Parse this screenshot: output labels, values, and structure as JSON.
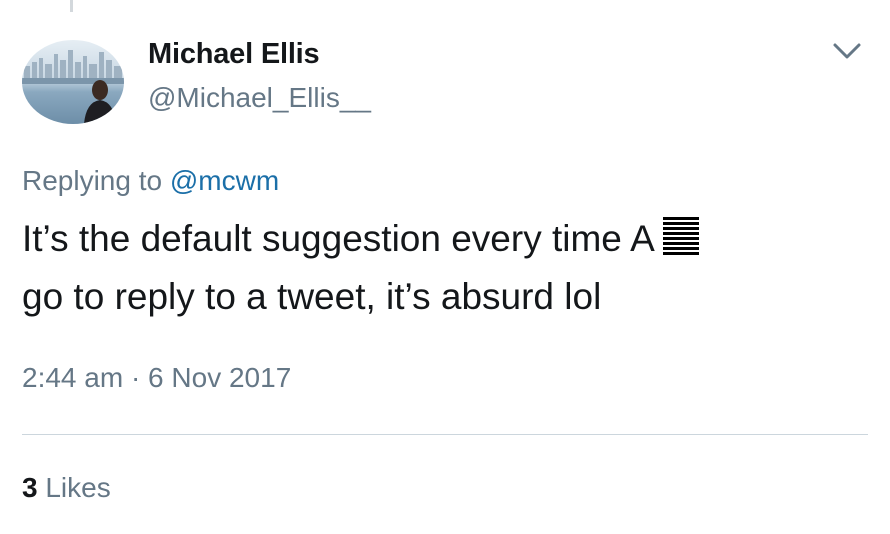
{
  "author": {
    "name": "Michael Ellis",
    "handle": "@Michael_Ellis__"
  },
  "reply": {
    "prefix": "Replying to",
    "mention": "@mcwm"
  },
  "tweet": {
    "line1": "It’s the default suggestion every time A",
    "line2": "go to reply to a tweet, it’s absurd lol",
    "glyph_icon": "unknown-symbol-icon"
  },
  "meta": {
    "timestamp": "2:44 am · 6 Nov 2017"
  },
  "stats": {
    "likes_count": "3",
    "likes_label": "Likes"
  },
  "colors": {
    "text": "#14171a",
    "secondary": "#657786",
    "link": "#1b6fa8",
    "divider": "#ccd6dd"
  }
}
